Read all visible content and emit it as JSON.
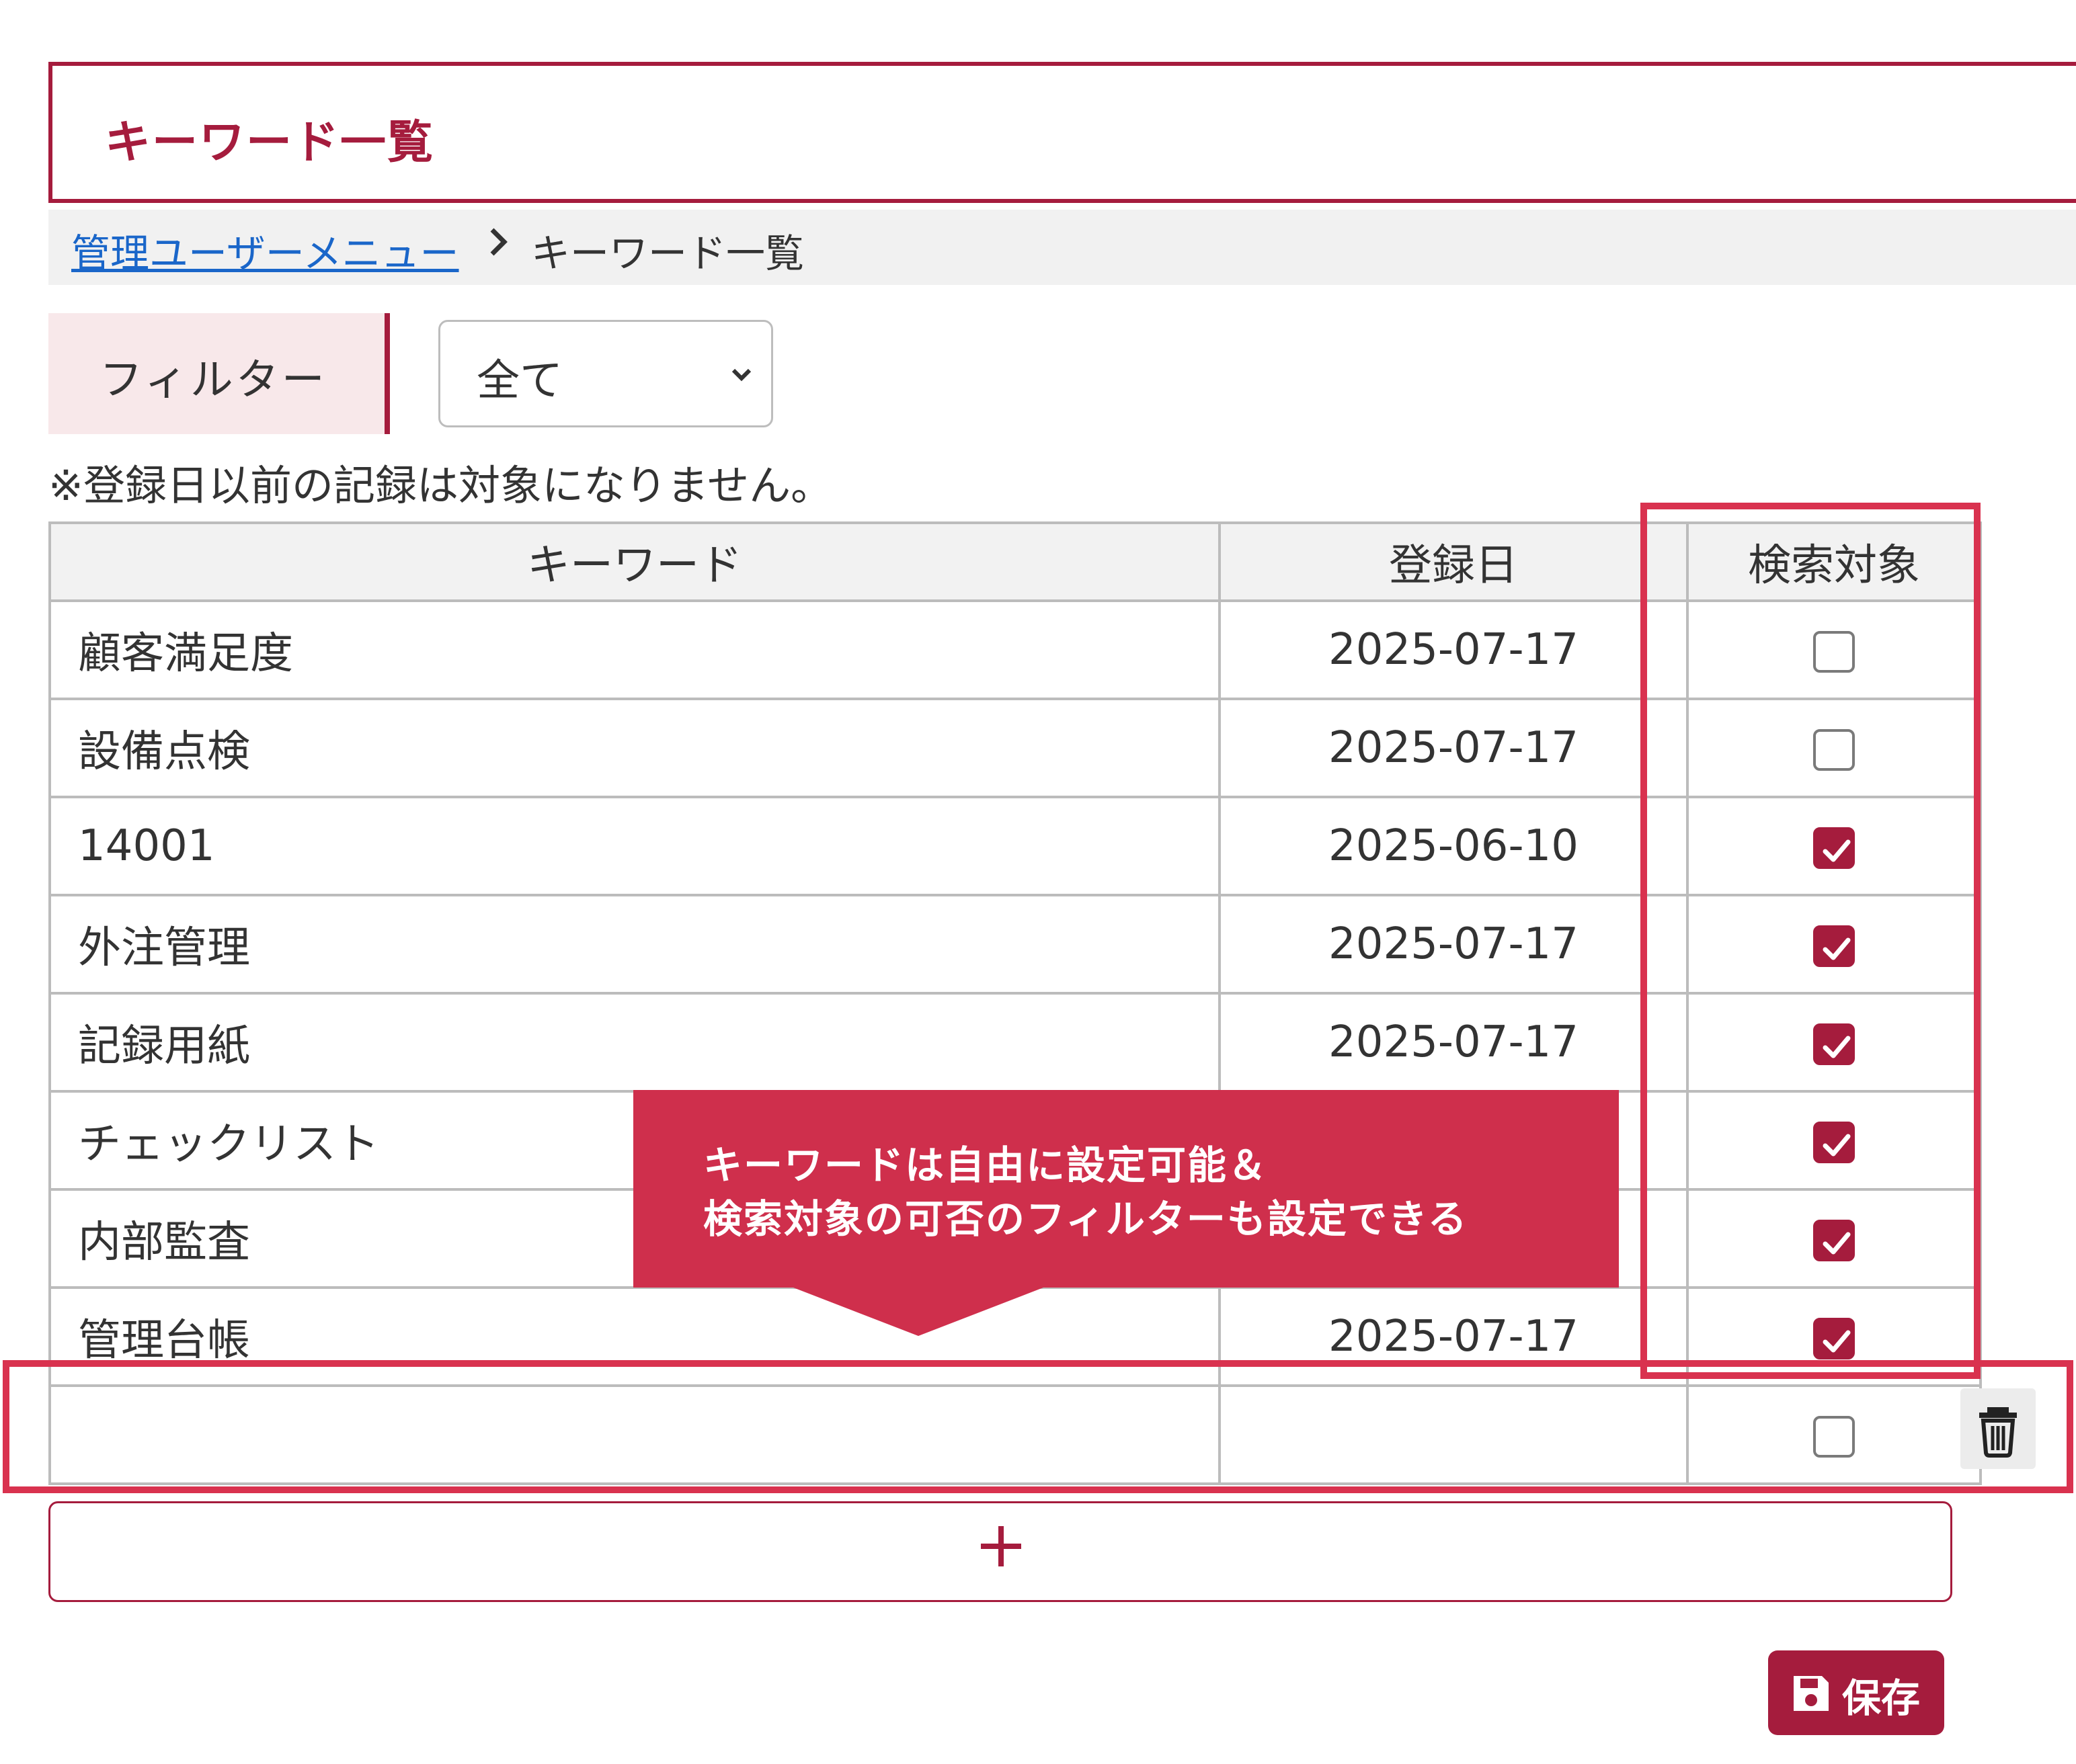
{
  "header": {
    "title": "キーワード一覧"
  },
  "breadcrumb": {
    "parent_link": "管理ユーザーメニュー",
    "separator": ">",
    "current": "キーワード一覧"
  },
  "filter": {
    "label": "フィルター",
    "selected_option": "全て",
    "chevron_icon": "chevron-down-icon"
  },
  "note": "※登録日以前の記録は対象になりません。",
  "table": {
    "columns": [
      "キーワード",
      "登録日",
      "検索対象"
    ],
    "rows": [
      {
        "keyword": "顧客満足度",
        "date": "2025-07-17",
        "searchable": false
      },
      {
        "keyword": "設備点検",
        "date": "2025-07-17",
        "searchable": false
      },
      {
        "keyword": "14001",
        "date": "2025-06-10",
        "searchable": true
      },
      {
        "keyword": "外注管理",
        "date": "2025-07-17",
        "searchable": true
      },
      {
        "keyword": "記録用紙",
        "date": "2025-07-17",
        "searchable": true
      },
      {
        "keyword": "チェックリスト",
        "date": "",
        "searchable": true
      },
      {
        "keyword": "内部監査",
        "date": "",
        "searchable": true
      },
      {
        "keyword": "管理台帳",
        "date": "2025-07-17",
        "searchable": true
      },
      {
        "keyword": "",
        "date": "",
        "searchable": false
      }
    ]
  },
  "new_row": {
    "delete_icon": "trash-icon"
  },
  "add_button": {
    "icon": "plus-icon"
  },
  "save_button": {
    "icon": "floppy-disk-icon",
    "label": "保存"
  },
  "callout": {
    "line1": "キーワードは自由に設定可能＆",
    "line2": "検索対象の可否のフィルターも設定できる"
  },
  "colors": {
    "brand": "#a51c3d",
    "annotation": "#cf2f4c",
    "highlight_border": "#d9324f",
    "link": "#1a66c9"
  }
}
